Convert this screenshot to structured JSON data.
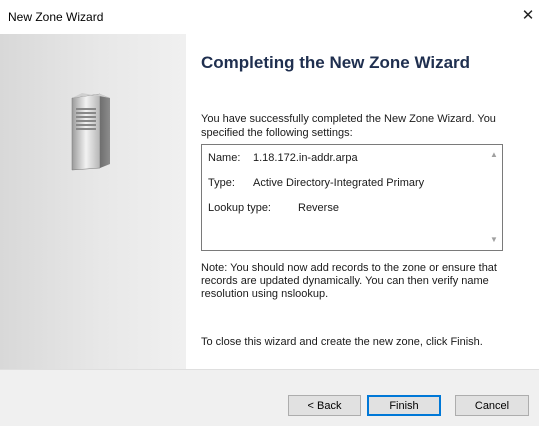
{
  "window": {
    "title": "New Zone Wizard",
    "close_glyph": "✕"
  },
  "page": {
    "heading": "Completing the New Zone Wizard",
    "intro": "You have successfully completed the New Zone Wizard. You specified the following settings:",
    "settings": [
      {
        "label": "Name:",
        "value": "1.18.172.in-addr.arpa"
      },
      {
        "label": "Type:",
        "value": "Active Directory-Integrated Primary"
      },
      {
        "label": "Lookup type:",
        "value": "Reverse"
      }
    ],
    "note": "Note: You should now add records to the zone or ensure that records are updated dynamically. You can then verify name resolution using nslookup.",
    "closing": "To close this wizard and create the new zone, click Finish."
  },
  "buttons": {
    "back": "< Back",
    "finish": "Finish",
    "cancel": "Cancel"
  },
  "icons": {
    "server": "server-icon",
    "scroll_up": "chevron-up-icon",
    "scroll_down": "chevron-down-icon"
  }
}
